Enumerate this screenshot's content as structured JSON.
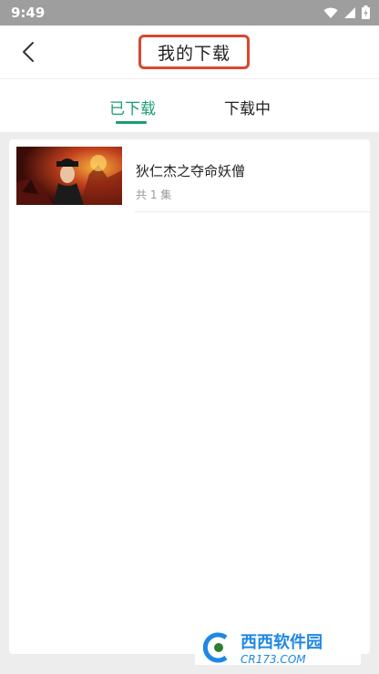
{
  "status_bar": {
    "time": "9:49"
  },
  "header": {
    "title": "我的下载"
  },
  "tabs": [
    {
      "label": "已下载",
      "active": true
    },
    {
      "label": "下载中",
      "active": false
    }
  ],
  "downloads": [
    {
      "title": "狄仁杰之夺命妖僧",
      "subtitle": "共 1 集"
    }
  ],
  "watermark": {
    "brand": "西西软件园",
    "site": "CR173.COM"
  },
  "colors": {
    "accent": "#1a9e6f",
    "highlight_box": "#d9462f",
    "watermark": "#1e88e5"
  }
}
